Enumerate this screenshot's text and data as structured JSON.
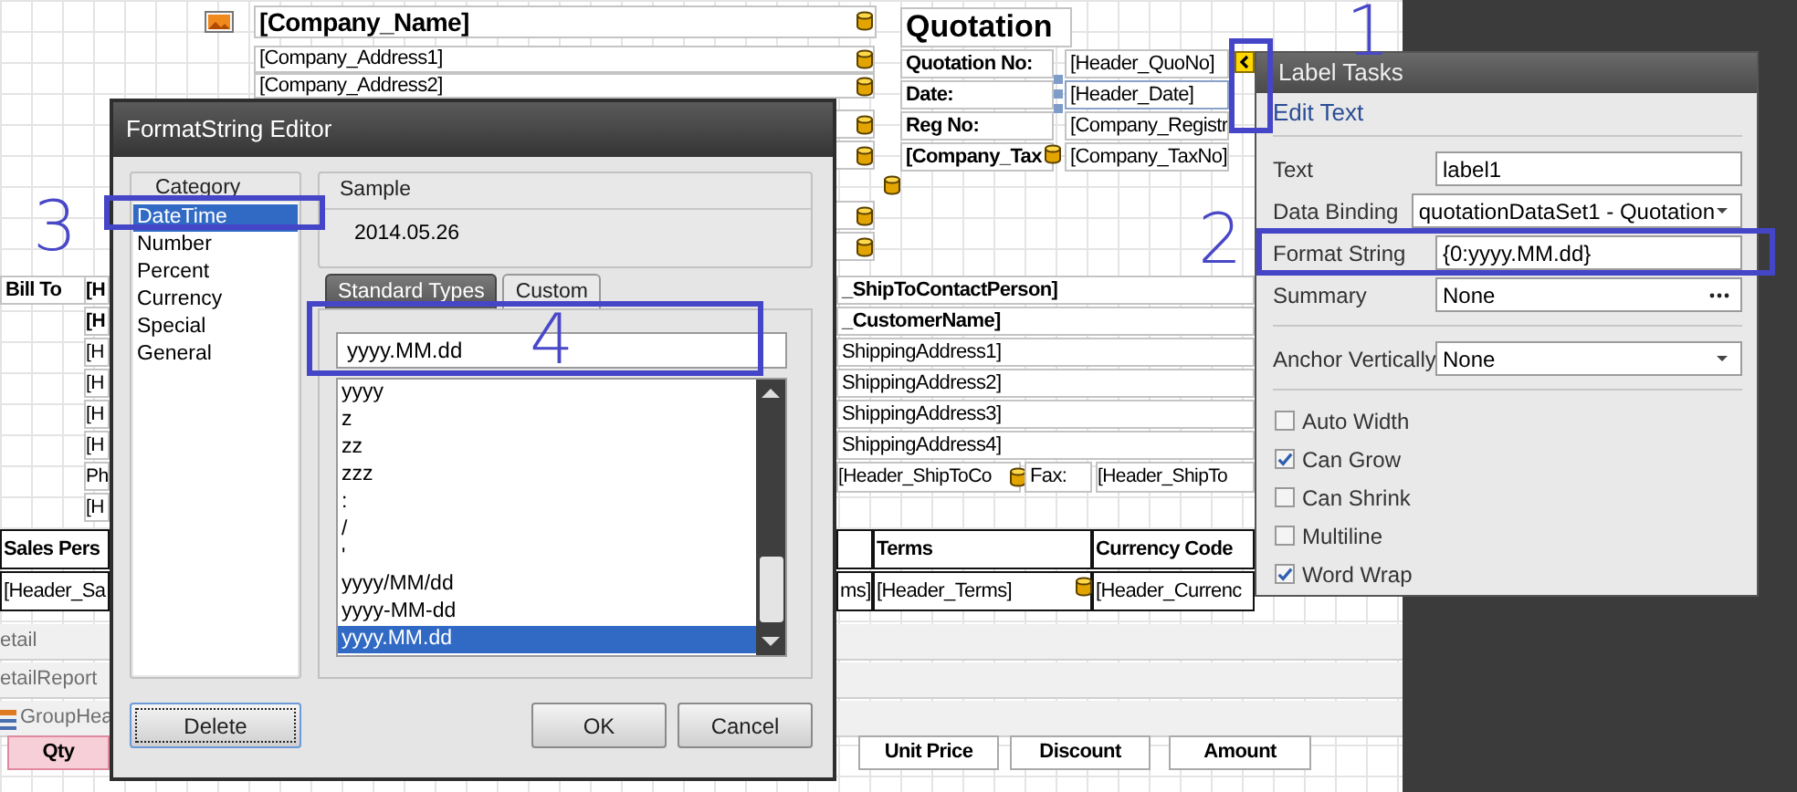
{
  "report": {
    "company_name": "[Company_Name]",
    "company_lines": [
      "[Company_Address1]",
      "[Company_Address2]"
    ],
    "quotation": {
      "title": "Quotation",
      "rows": [
        {
          "label": "Quotation No:",
          "value": "[Header_QuoNo]",
          "selected": false
        },
        {
          "label": "Date:",
          "value": "[Header_Date]",
          "selected": true
        },
        {
          "label": "Reg No:",
          "value": "[Company_Registr",
          "selected": false
        },
        {
          "label": "[Company_Tax",
          "value": "[Company_TaxNo]",
          "selected": false
        }
      ]
    },
    "bill_to": {
      "heading": "Bill To",
      "lines": [
        "[H",
        "[H",
        "[H",
        "[H",
        "[H",
        "[H",
        "Ph",
        "[H"
      ]
    },
    "ship_to": {
      "lines": [
        "_ShipToContactPerson]",
        "_CustomerName]",
        "ShippingAddress1]",
        "ShippingAddress2]",
        "ShippingAddress3]",
        "ShippingAddress4]"
      ],
      "phone": "[Header_ShipToCo",
      "fax_label": "Fax:",
      "fax": "[Header_ShipTo"
    },
    "header_table": {
      "columns": [
        {
          "heading": "Sales Pers",
          "cell": "[Header_Sa"
        },
        {
          "cell": "ms]"
        },
        {
          "heading": "Terms",
          "cell": "[Header_Terms]"
        },
        {
          "heading": "Currency Code",
          "cell": "[Header_Currenc"
        }
      ]
    },
    "bands": [
      "etail",
      "etailReport",
      "GroupHea"
    ],
    "detail_columns": [
      "Qty",
      "Unit Price",
      "Discount",
      "Amount"
    ]
  },
  "format_dialog": {
    "title": "FormatString Editor",
    "category_label": "Category",
    "categories": [
      {
        "label": "DateTime",
        "selected": true
      },
      {
        "label": "Number",
        "selected": false
      },
      {
        "label": "Percent",
        "selected": false
      },
      {
        "label": "Currency",
        "selected": false
      },
      {
        "label": "Special",
        "selected": false
      },
      {
        "label": "General",
        "selected": false
      }
    ],
    "sample_label": "Sample",
    "sample": "2014.05.26",
    "tabs": [
      {
        "label": "Standard Types",
        "selected": true
      },
      {
        "label": "Custom",
        "selected": false
      }
    ],
    "format": "yyyy.MM.dd",
    "formats": [
      {
        "label": "yyyy",
        "selected": false
      },
      {
        "label": "z",
        "selected": false
      },
      {
        "label": "zz",
        "selected": false
      },
      {
        "label": "zzz",
        "selected": false
      },
      {
        "label": ":",
        "selected": false
      },
      {
        "label": "/",
        "selected": false
      },
      {
        "label": "'",
        "selected": false
      },
      {
        "label": "yyyy/MM/dd",
        "selected": false
      },
      {
        "label": "yyyy-MM-dd",
        "selected": false
      },
      {
        "label": "yyyy.MM.dd",
        "selected": true
      }
    ],
    "buttons": [
      "Delete",
      "OK",
      "Cancel"
    ]
  },
  "label_tasks": {
    "title": "Label Tasks",
    "link": "Edit Text",
    "fields": [
      {
        "label": "Text",
        "kind": "text",
        "value": "label1"
      },
      {
        "label": "Data Binding",
        "kind": "dropdown",
        "value": "quotationDataSet1 - Quotation"
      },
      {
        "label": "Format String",
        "kind": "text",
        "value": "{0:yyyy.MM.dd}"
      },
      {
        "label": "Summary",
        "kind": "ellipsis",
        "value": "None"
      },
      {
        "label": "Anchor Vertically",
        "kind": "dropdown",
        "value": "None"
      }
    ],
    "options": [
      {
        "label": "Auto Width",
        "checked": false
      },
      {
        "label": "Can Grow",
        "checked": true
      },
      {
        "label": "Can Shrink",
        "checked": false
      },
      {
        "label": "Multiline",
        "checked": false
      },
      {
        "label": "Word Wrap",
        "checked": true
      }
    ]
  },
  "annotations": [
    {
      "number": "1"
    },
    {
      "number": "2"
    },
    {
      "number": "3"
    },
    {
      "number": "4"
    }
  ]
}
